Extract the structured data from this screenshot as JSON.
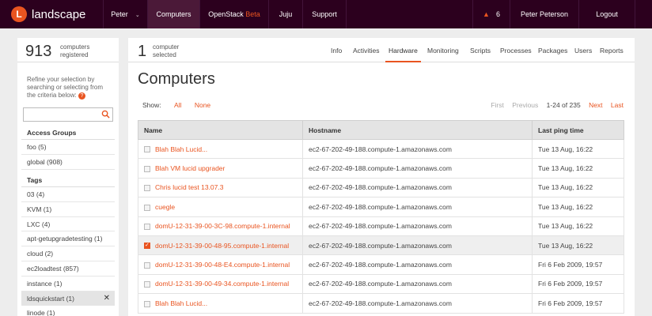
{
  "nav": {
    "logo_text": "landscape",
    "logo_letter": "L",
    "user_menu": "Peter",
    "items": [
      "Computers",
      "OpenStack",
      "Juju",
      "Support"
    ],
    "openstack_badge": "Beta",
    "alerts_count": "6",
    "user_name": "Peter Peterson",
    "logout": "Logout"
  },
  "sidebar": {
    "count": "913",
    "count_label_1": "computers",
    "count_label_2": "registered",
    "refine_text": "Refine your selection by searching or selecting from the criteria below:",
    "search_placeholder": "",
    "access_groups_heading": "Access Groups",
    "access_groups": [
      "foo (5)",
      "global (908)"
    ],
    "tags_heading": "Tags",
    "tags": [
      "03 (4)",
      "KVM (1)",
      "LXC (4)",
      "apt-getupgradetesting (1)",
      "cloud (2)",
      "ec2loadtest (857)",
      "instance (1)",
      "ldsquickstart (1)",
      "linode (1)"
    ]
  },
  "main": {
    "selected_count": "1",
    "selected_label_1": "computer",
    "selected_label_2": "selected",
    "tabs": [
      "Info",
      "Activities",
      "Hardware",
      "Monitoring",
      "Scripts",
      "Processes",
      "Packages",
      "Users",
      "Reports"
    ],
    "active_tab": "Hardware",
    "title": "Computers",
    "show_label": "Show:",
    "show_all": "All",
    "show_none": "None",
    "pager": {
      "first": "First",
      "previous": "Previous",
      "range": "1-24 of 235",
      "next": "Next",
      "last": "Last"
    },
    "columns": [
      "Name",
      "Hostname",
      "Last ping time"
    ],
    "rows": [
      {
        "name": "Blah Blah Lucid...",
        "host": "ec2-67-202-49-188.compute-1.amazonaws.com",
        "ping": "Tue 13 Aug, 16:22",
        "checked": false
      },
      {
        "name": "Blah VM lucid upgrader",
        "host": "ec2-67-202-49-188.compute-1.amazonaws.com",
        "ping": "Tue 13 Aug, 16:22",
        "checked": false
      },
      {
        "name": "Chris lucid test 13.07.3",
        "host": "ec2-67-202-49-188.compute-1.amazonaws.com",
        "ping": "Tue 13 Aug, 16:22",
        "checked": false
      },
      {
        "name": "cuegle",
        "host": "ec2-67-202-49-188.compute-1.amazonaws.com",
        "ping": "Tue 13 Aug, 16:22",
        "checked": false
      },
      {
        "name": "domU-12-31-39-00-3C-98.compute-1.internal",
        "host": "ec2-67-202-49-188.compute-1.amazonaws.com",
        "ping": "Tue 13 Aug, 16:22",
        "checked": false
      },
      {
        "name": "domU-12-31-39-00-48-95.compute-1.internal",
        "host": "ec2-67-202-49-188.compute-1.amazonaws.com",
        "ping": "Tue 13 Aug, 16:22",
        "checked": true
      },
      {
        "name": "domU-12-31-39-00-48-E4.compute-1.internal",
        "host": "ec2-67-202-49-188.compute-1.amazonaws.com",
        "ping": "Fri 6 Feb 2009, 19:57",
        "checked": false
      },
      {
        "name": "domU-12-31-39-00-49-34.compute-1.internal",
        "host": "ec2-67-202-49-188.compute-1.amazonaws.com",
        "ping": "Fri 6 Feb 2009, 19:57",
        "checked": false
      },
      {
        "name": "Blah Blah Lucid...",
        "host": "ec2-67-202-49-188.compute-1.amazonaws.com",
        "ping": "Fri 6 Feb 2009, 19:57",
        "checked": false
      }
    ]
  },
  "colors": {
    "topbar": "#2c001e",
    "accent": "#e95420"
  }
}
